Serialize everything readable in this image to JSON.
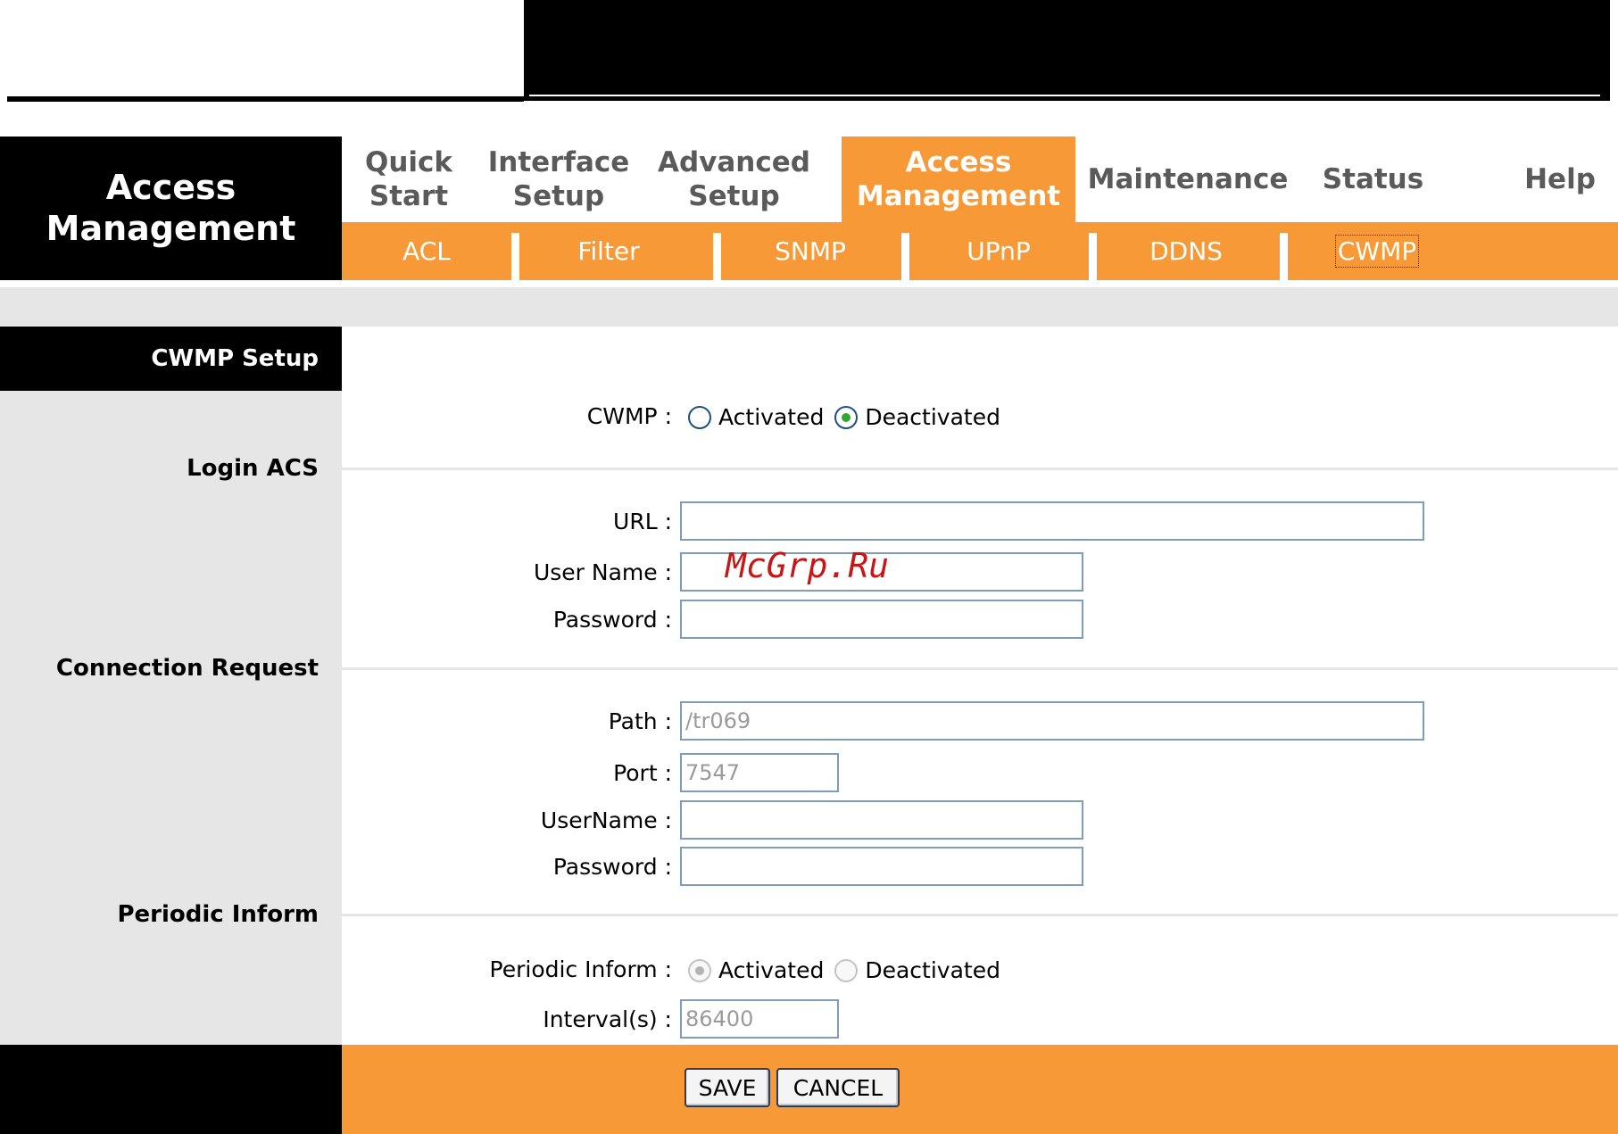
{
  "left_title": [
    "Access",
    "Management"
  ],
  "nav": {
    "items": [
      {
        "label": "Quick\nStart"
      },
      {
        "label": "Interface\nSetup"
      },
      {
        "label": "Advanced\nSetup"
      },
      {
        "label": "Access\nManagement"
      },
      {
        "label": "Maintenance"
      },
      {
        "label": "Status"
      },
      {
        "label": "Help"
      }
    ],
    "active": "Access Management"
  },
  "subnav": {
    "items": [
      "ACL",
      "Filter",
      "SNMP",
      "UPnP",
      "DDNS",
      "CWMP"
    ],
    "active": "CWMP"
  },
  "section": {
    "title": "CWMP Setup",
    "login_acs": "Login ACS",
    "connection_request": "Connection Request",
    "periodic_inform": "Periodic Inform"
  },
  "form": {
    "cwmp_label": "CWMP :",
    "activated": "Activated",
    "deactivated": "Deactivated",
    "cwmp_selected": "Deactivated",
    "url_label": "URL :",
    "url_value": "",
    "username_label": "User Name :",
    "username_value": "",
    "password_label": "Password :",
    "password_value": "",
    "path_label": "Path :",
    "path_value": "/tr069",
    "port_label": "Port :",
    "port_value": "7547",
    "cr_username_label": "UserName :",
    "cr_username_value": "",
    "cr_password_label": "Password :",
    "cr_password_value": "",
    "periodic_label": "Periodic Inform :",
    "periodic_selected": "Activated",
    "interval_label": "Interval(s) :",
    "interval_value": "86400"
  },
  "buttons": {
    "save": "SAVE",
    "cancel": "CANCEL"
  },
  "watermark": "McGrp.Ru",
  "colors": {
    "accent": "#f79936",
    "panel_gray": "#e6e6e6",
    "header_black": "#000000",
    "nav_text": "#5a5a5a",
    "field_border": "#7f9db9"
  }
}
